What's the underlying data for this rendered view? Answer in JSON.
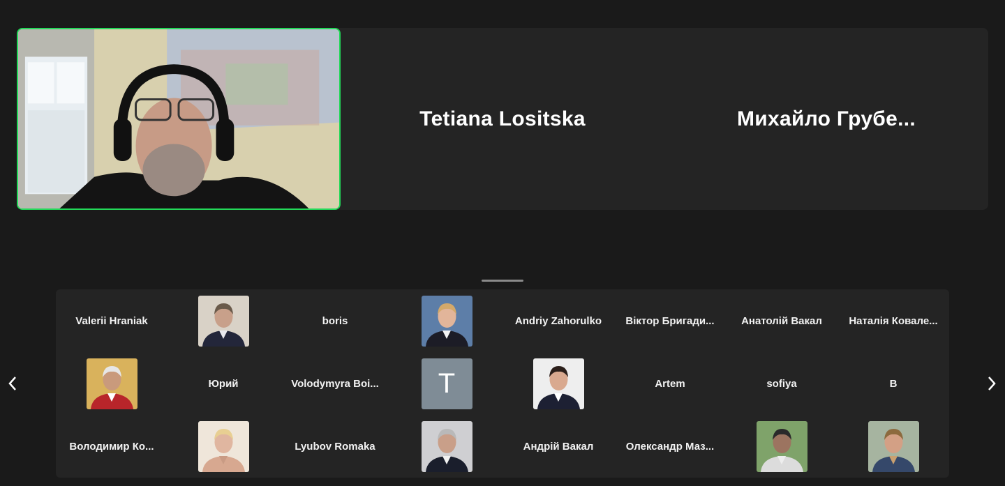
{
  "speaker_strip": {
    "active_speaker": {
      "has_video": true,
      "highlight_color": "#23d959"
    },
    "name_tiles": [
      "Tetiana Lositska",
      "Михайло  Грубе..."
    ]
  },
  "gallery": {
    "nav": {
      "prev_icon": "chevron-left-icon",
      "next_icon": "chevron-right-icon"
    },
    "tiles": [
      {
        "type": "name",
        "label": "Valerii Hraniak"
      },
      {
        "type": "photo",
        "avatar": "man-suit-icon"
      },
      {
        "type": "name",
        "label": "boris"
      },
      {
        "type": "photo",
        "avatar": "man-smiling-icon"
      },
      {
        "type": "name",
        "label": "Andriy Zahorulko"
      },
      {
        "type": "name",
        "label": "Віктор  Бригади..."
      },
      {
        "type": "name",
        "label": "Анатолій Вакал"
      },
      {
        "type": "name",
        "label": "Наталія  Ковале..."
      },
      {
        "type": "photo",
        "avatar": "man-outdoor-icon"
      },
      {
        "type": "name",
        "label": "Юрий"
      },
      {
        "type": "name",
        "label": "Volodymyra  Boi..."
      },
      {
        "type": "letter",
        "label": "T"
      },
      {
        "type": "photo",
        "avatar": "woman-dark-hair-icon"
      },
      {
        "type": "name",
        "label": "Artem"
      },
      {
        "type": "name",
        "label": "sofiya"
      },
      {
        "type": "name",
        "label": "В"
      },
      {
        "type": "name",
        "label": "Володимир  Ко..."
      },
      {
        "type": "photo",
        "avatar": "woman-blonde-icon"
      },
      {
        "type": "name",
        "label": "Lyubov Romaka"
      },
      {
        "type": "photo",
        "avatar": "man-grey-hair-icon"
      },
      {
        "type": "name",
        "label": "Андрій Вакал"
      },
      {
        "type": "name",
        "label": "Олександр  Маз..."
      },
      {
        "type": "photo",
        "avatar": "man-river-icon"
      },
      {
        "type": "photo",
        "avatar": "man-bearded-icon"
      }
    ]
  }
}
